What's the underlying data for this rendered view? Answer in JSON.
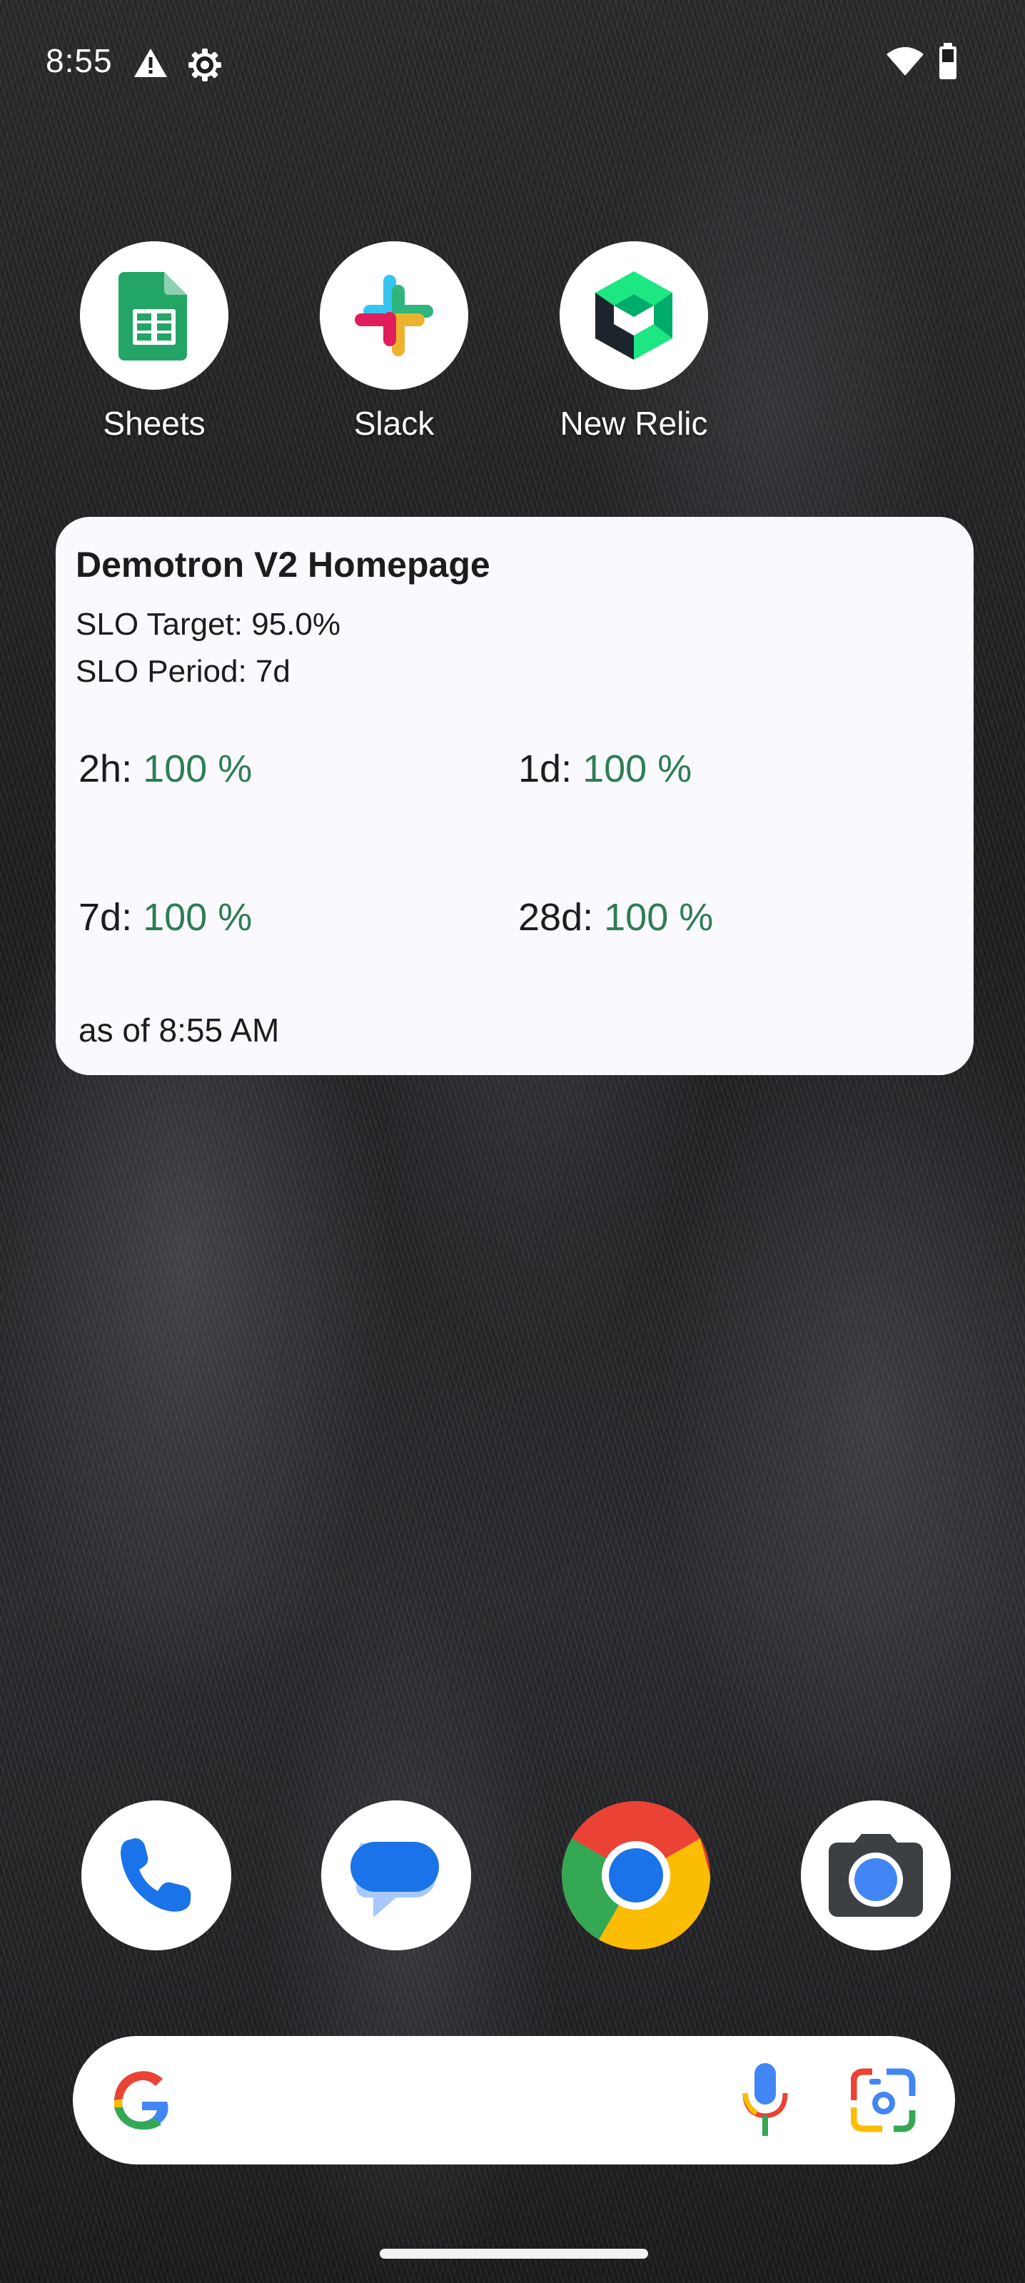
{
  "status_bar": {
    "time": "8:55",
    "icons": [
      "warning-icon",
      "settings-icon",
      "wifi-icon",
      "battery-icon"
    ]
  },
  "apps": [
    {
      "label": "Sheets",
      "icon": "sheets-icon"
    },
    {
      "label": "Slack",
      "icon": "slack-icon"
    },
    {
      "label": "New Relic",
      "icon": "new-relic-icon"
    }
  ],
  "widget": {
    "title": "Demotron V2 Homepage",
    "slo_target": "SLO Target: 95.0%",
    "slo_period": "SLO Period: 7d",
    "metrics": [
      {
        "label": "2h:",
        "value": "100 %"
      },
      {
        "label": "1d:",
        "value": "100 %"
      },
      {
        "label": "7d:",
        "value": "100 %"
      },
      {
        "label": "28d:",
        "value": "100 %"
      }
    ],
    "as_of": "as of 8:55 AM",
    "value_color": "#2e7d55"
  },
  "dock": [
    "phone-icon",
    "messages-icon",
    "chrome-icon",
    "camera-icon"
  ],
  "search": {
    "icons": [
      "google-g-icon",
      "microphone-icon",
      "google-lens-icon"
    ]
  }
}
